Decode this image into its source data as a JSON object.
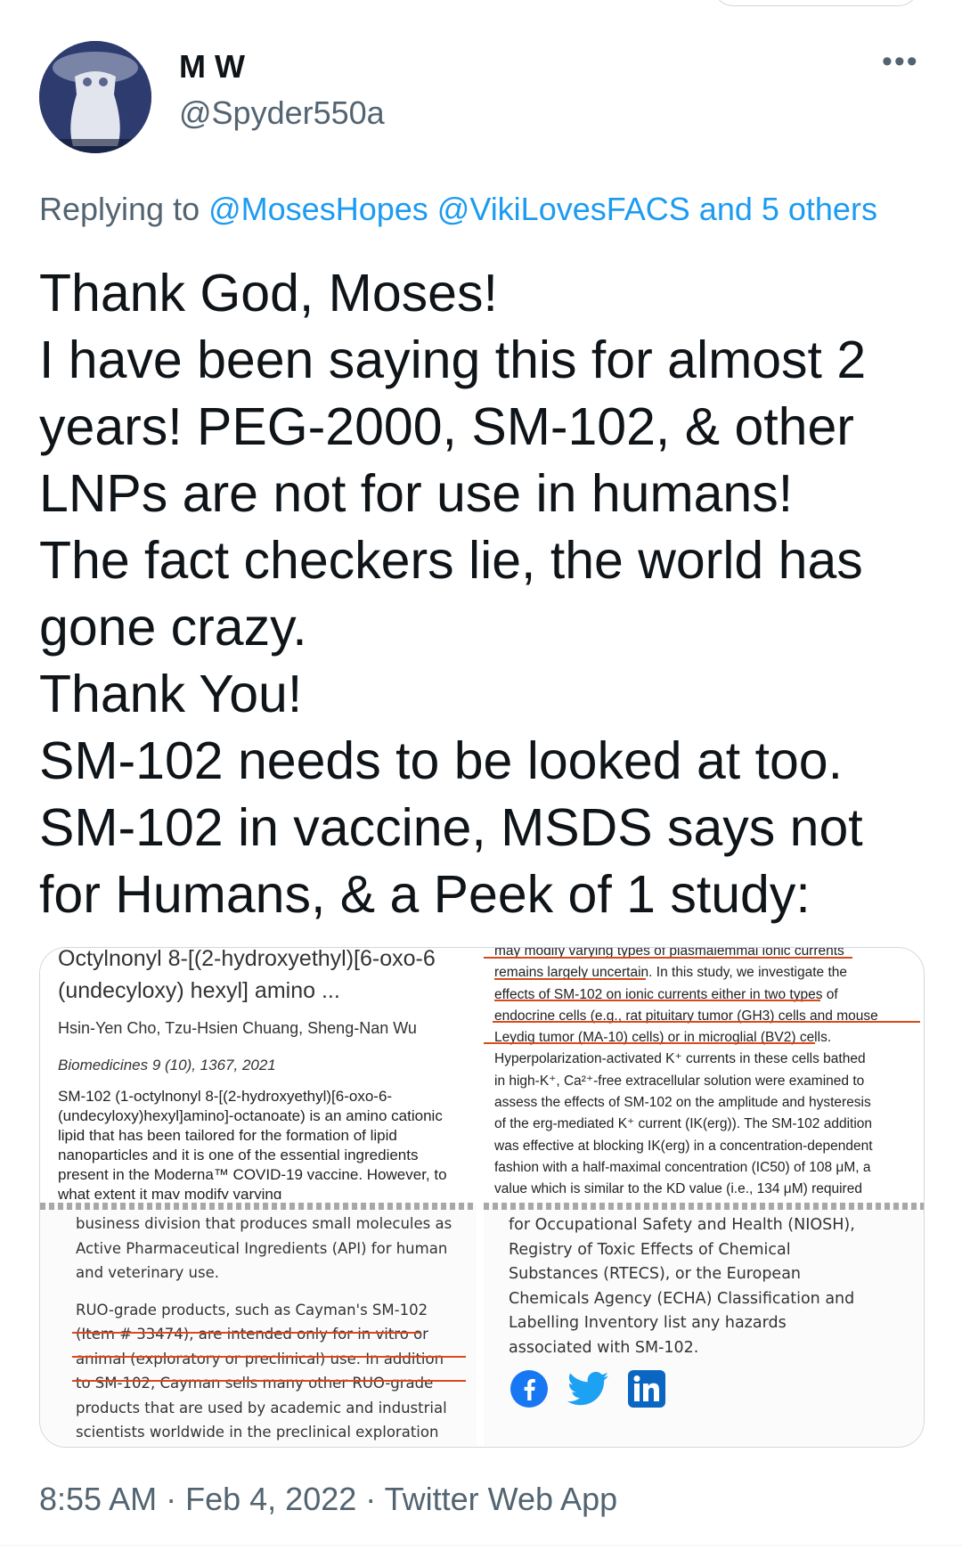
{
  "author": {
    "display_name": "M W",
    "handle": "@Spyder550a",
    "avatar": "avatar-image"
  },
  "more_menu": "•••",
  "reply": {
    "prefix": "Replying to",
    "mentions": [
      "@MosesHopes",
      "@VikiLovesFACS"
    ],
    "others": "and 5 others"
  },
  "tweet_lines": [
    "Thank God, Moses!",
    "I have been saying this for almost 2",
    "years! PEG-2000, SM-102, & other",
    "LNPs are not for use in humans!",
    "The fact checkers lie, the world has",
    "gone crazy.",
    "Thank You!",
    "SM-102 needs to be looked at too.",
    "SM-102 in vaccine, MSDS says not",
    "for Humans, & a Peek of 1 study:"
  ],
  "media": {
    "paper": {
      "title_cut": "Octylnonyl 8-[(2-hydroxyethyl)[6-oxo-6",
      "title_2": "(undecyloxy) hexyl] amino ...",
      "authors": "Hsin-Yen Cho, Tzu-Hsien Chuang, Sheng-Nan Wu",
      "journal": "Biomedicines 9 (10), 1367, 2021",
      "abstract": "SM-102 (1-octylnonyl 8-[(2-hydroxyethyl)[6-oxo-6-(undecyloxy)hexyl]amino]-octanoate) is an amino cationic lipid that has been tailored for the formation of lipid nanoparticles and it is one of the essential ingredients present in the Moderna™ COVID-19 vaccine. However, to what extent it may modify varying"
    },
    "study_lines": [
      "may modify varying types of plasmalemmal ionic currents",
      "remains largely uncertain. In this study, we investigate the",
      "effects of SM-102 on ionic currents either in two types of",
      "endocrine cells (e.g., rat pituitary tumor (GH3) cells and mouse",
      "Leydig tumor (MA-10) cells) or in microglial (BV2) cells.",
      "Hyperpolarization-activated K⁺ currents in these cells bathed",
      "in high-K⁺, Ca²⁺-free extracellular solution were examined to",
      "assess the effects of SM-102 on the amplitude and hysteresis",
      "of the erg-mediated K⁺ current (IK(erg)). The SM-102 addition",
      "was effective at blocking IK(erg) in a concentration-dependent",
      "fashion with a half-maximal concentration (IC50) of 108 μM, a",
      "value which is similar to the KD value (i.e., 134 μM) required"
    ],
    "cayman_lines": [
      "business division that produces small molecules as",
      "Active Pharmaceutical Ingredients (API) for human",
      "and veterinary use.",
      "",
      "RUO-grade products, such as Cayman's SM-102",
      "(Item # 33474), are intended only for in vitro or",
      "animal (exploratory or preclinical) use. In addition",
      "to SM-102, Cayman sells many other RUO-grade",
      "products that are used by academic and industrial",
      "scientists worldwide in the preclinical exploration"
    ],
    "niosh_lines": [
      "for Occupational Safety and Health (NIOSH),",
      "Registry  of  Toxic  Effects  of  Chemical",
      "Substances   (RTECS),   or   the   European",
      "Chemicals Agency (ECHA) Classification and",
      "Labelling    Inventory    list    any    hazards",
      "associated with SM-102."
    ],
    "social_icons": [
      "facebook-icon",
      "twitter-icon",
      "linkedin-icon"
    ],
    "colors": {
      "facebook": "#1877f2",
      "twitter": "#1da1f2",
      "linkedin": "#0a66c2",
      "underline": "#d84a1b"
    }
  },
  "footer": {
    "time": "8:55 AM",
    "date": "Feb 4, 2022",
    "app": "Twitter Web App",
    "separator": "·"
  },
  "colors": {
    "link": "#1d9bf0",
    "secondary": "#536471",
    "text": "#0f1419"
  }
}
